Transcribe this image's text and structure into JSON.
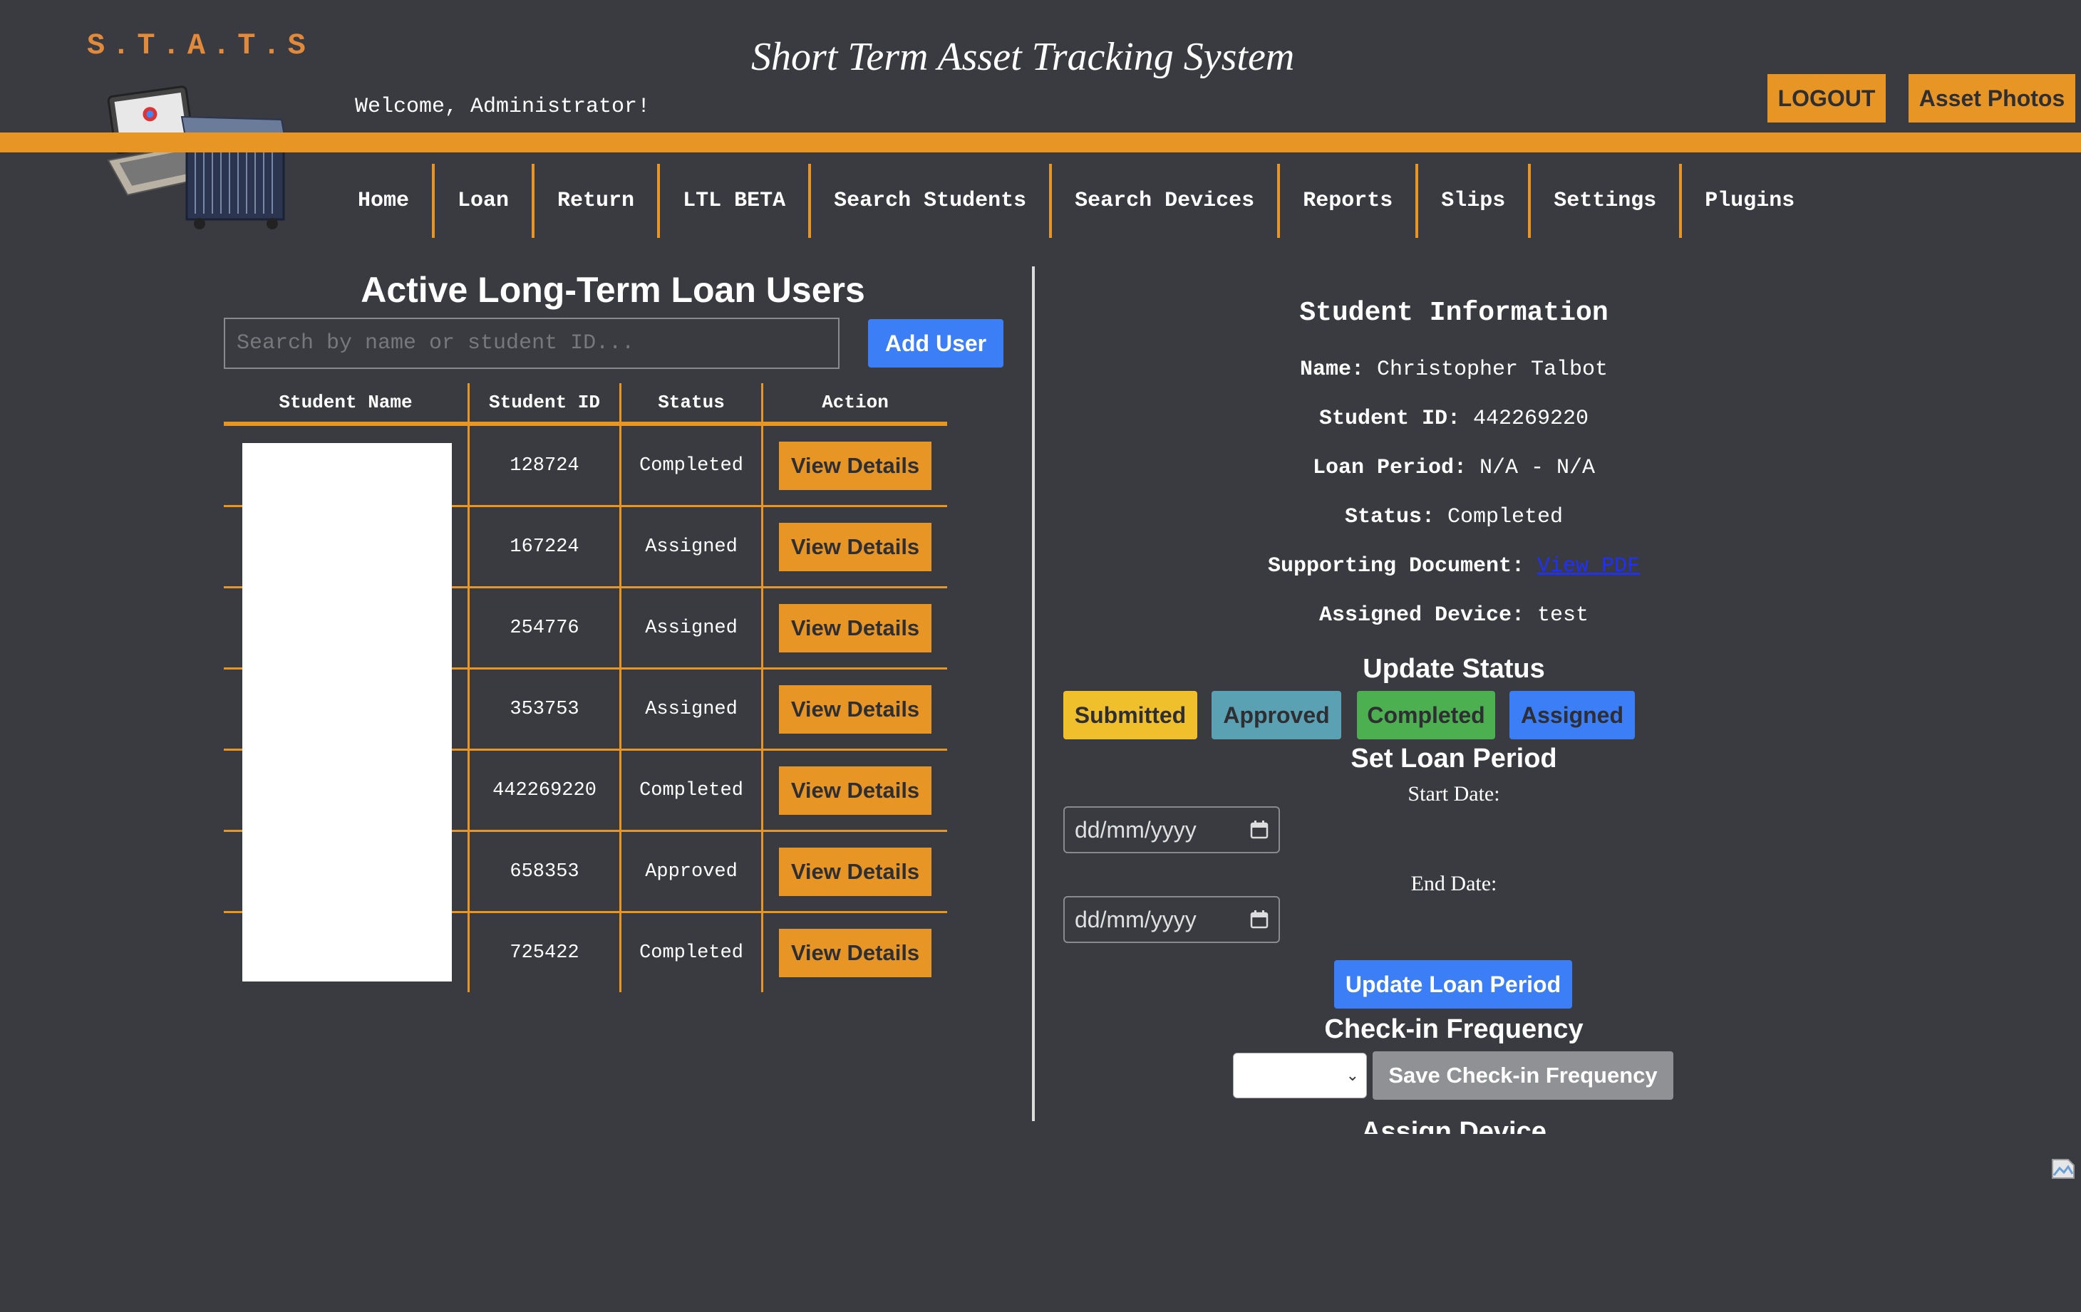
{
  "header": {
    "logo_text": "S.T.A.T.S",
    "app_title": "Short Term Asset Tracking System",
    "welcome": "Welcome, Administrator!",
    "logout_label": "LOGOUT",
    "asset_photos_label": "Asset Photos"
  },
  "nav": {
    "items": [
      {
        "label": "Home"
      },
      {
        "label": "Loan"
      },
      {
        "label": "Return"
      },
      {
        "label": "LTL BETA"
      },
      {
        "label": "Search Students"
      },
      {
        "label": "Search Devices"
      },
      {
        "label": "Reports"
      },
      {
        "label": "Slips"
      },
      {
        "label": "Settings"
      },
      {
        "label": "Plugins"
      }
    ]
  },
  "ltl": {
    "title": "Active Long-Term Loan Users",
    "search_placeholder": "Search by name or student ID...",
    "add_user_label": "Add User",
    "columns": [
      "Student Name",
      "Student ID",
      "Status",
      "Action"
    ],
    "rows": [
      {
        "student_id": "128724",
        "status": "Completed",
        "action": "View Details"
      },
      {
        "student_id": "167224",
        "status": "Assigned",
        "action": "View Details"
      },
      {
        "student_id": "254776",
        "status": "Assigned",
        "action": "View Details"
      },
      {
        "student_id": "353753",
        "status": "Assigned",
        "action": "View Details"
      },
      {
        "student_id": "442269220",
        "status": "Completed",
        "action": "View Details"
      },
      {
        "student_id": "658353",
        "status": "Approved",
        "action": "View Details"
      },
      {
        "student_id": "725422",
        "status": "Completed",
        "action": "View Details"
      }
    ]
  },
  "student_info": {
    "title": "Student Information",
    "name_label": "Name:",
    "name": "Christopher Talbot",
    "id_label": "Student ID:",
    "student_id": "442269220",
    "loan_period_label": "Loan Period:",
    "loan_period": "N/A - N/A",
    "status_label": "Status:",
    "status": "Completed",
    "doc_label": "Supporting Document:",
    "doc_link": "View PDF",
    "device_label": "Assigned Device:",
    "device": "test"
  },
  "update_status": {
    "title": "Update Status",
    "buttons": [
      {
        "label": "Submitted",
        "color": "#f0c02c"
      },
      {
        "label": "Approved",
        "color": "#5aa1b4"
      },
      {
        "label": "Completed",
        "color": "#4caf50"
      },
      {
        "label": "Assigned",
        "color": "#3b7ef5"
      }
    ]
  },
  "loan_period": {
    "title": "Set Loan Period",
    "start_label": "Start Date:",
    "end_label": "End Date:",
    "date_placeholder": "dd/mm/yyyy",
    "update_label": "Update Loan Period"
  },
  "checkin": {
    "title": "Check-in Frequency",
    "selected": "",
    "save_label": "Save Check-in Frequency"
  },
  "assign_device": {
    "title": "Assign Device"
  },
  "colors": {
    "accent": "#e79626",
    "background": "#3a3b40",
    "primary_button": "#3b7ef5"
  }
}
